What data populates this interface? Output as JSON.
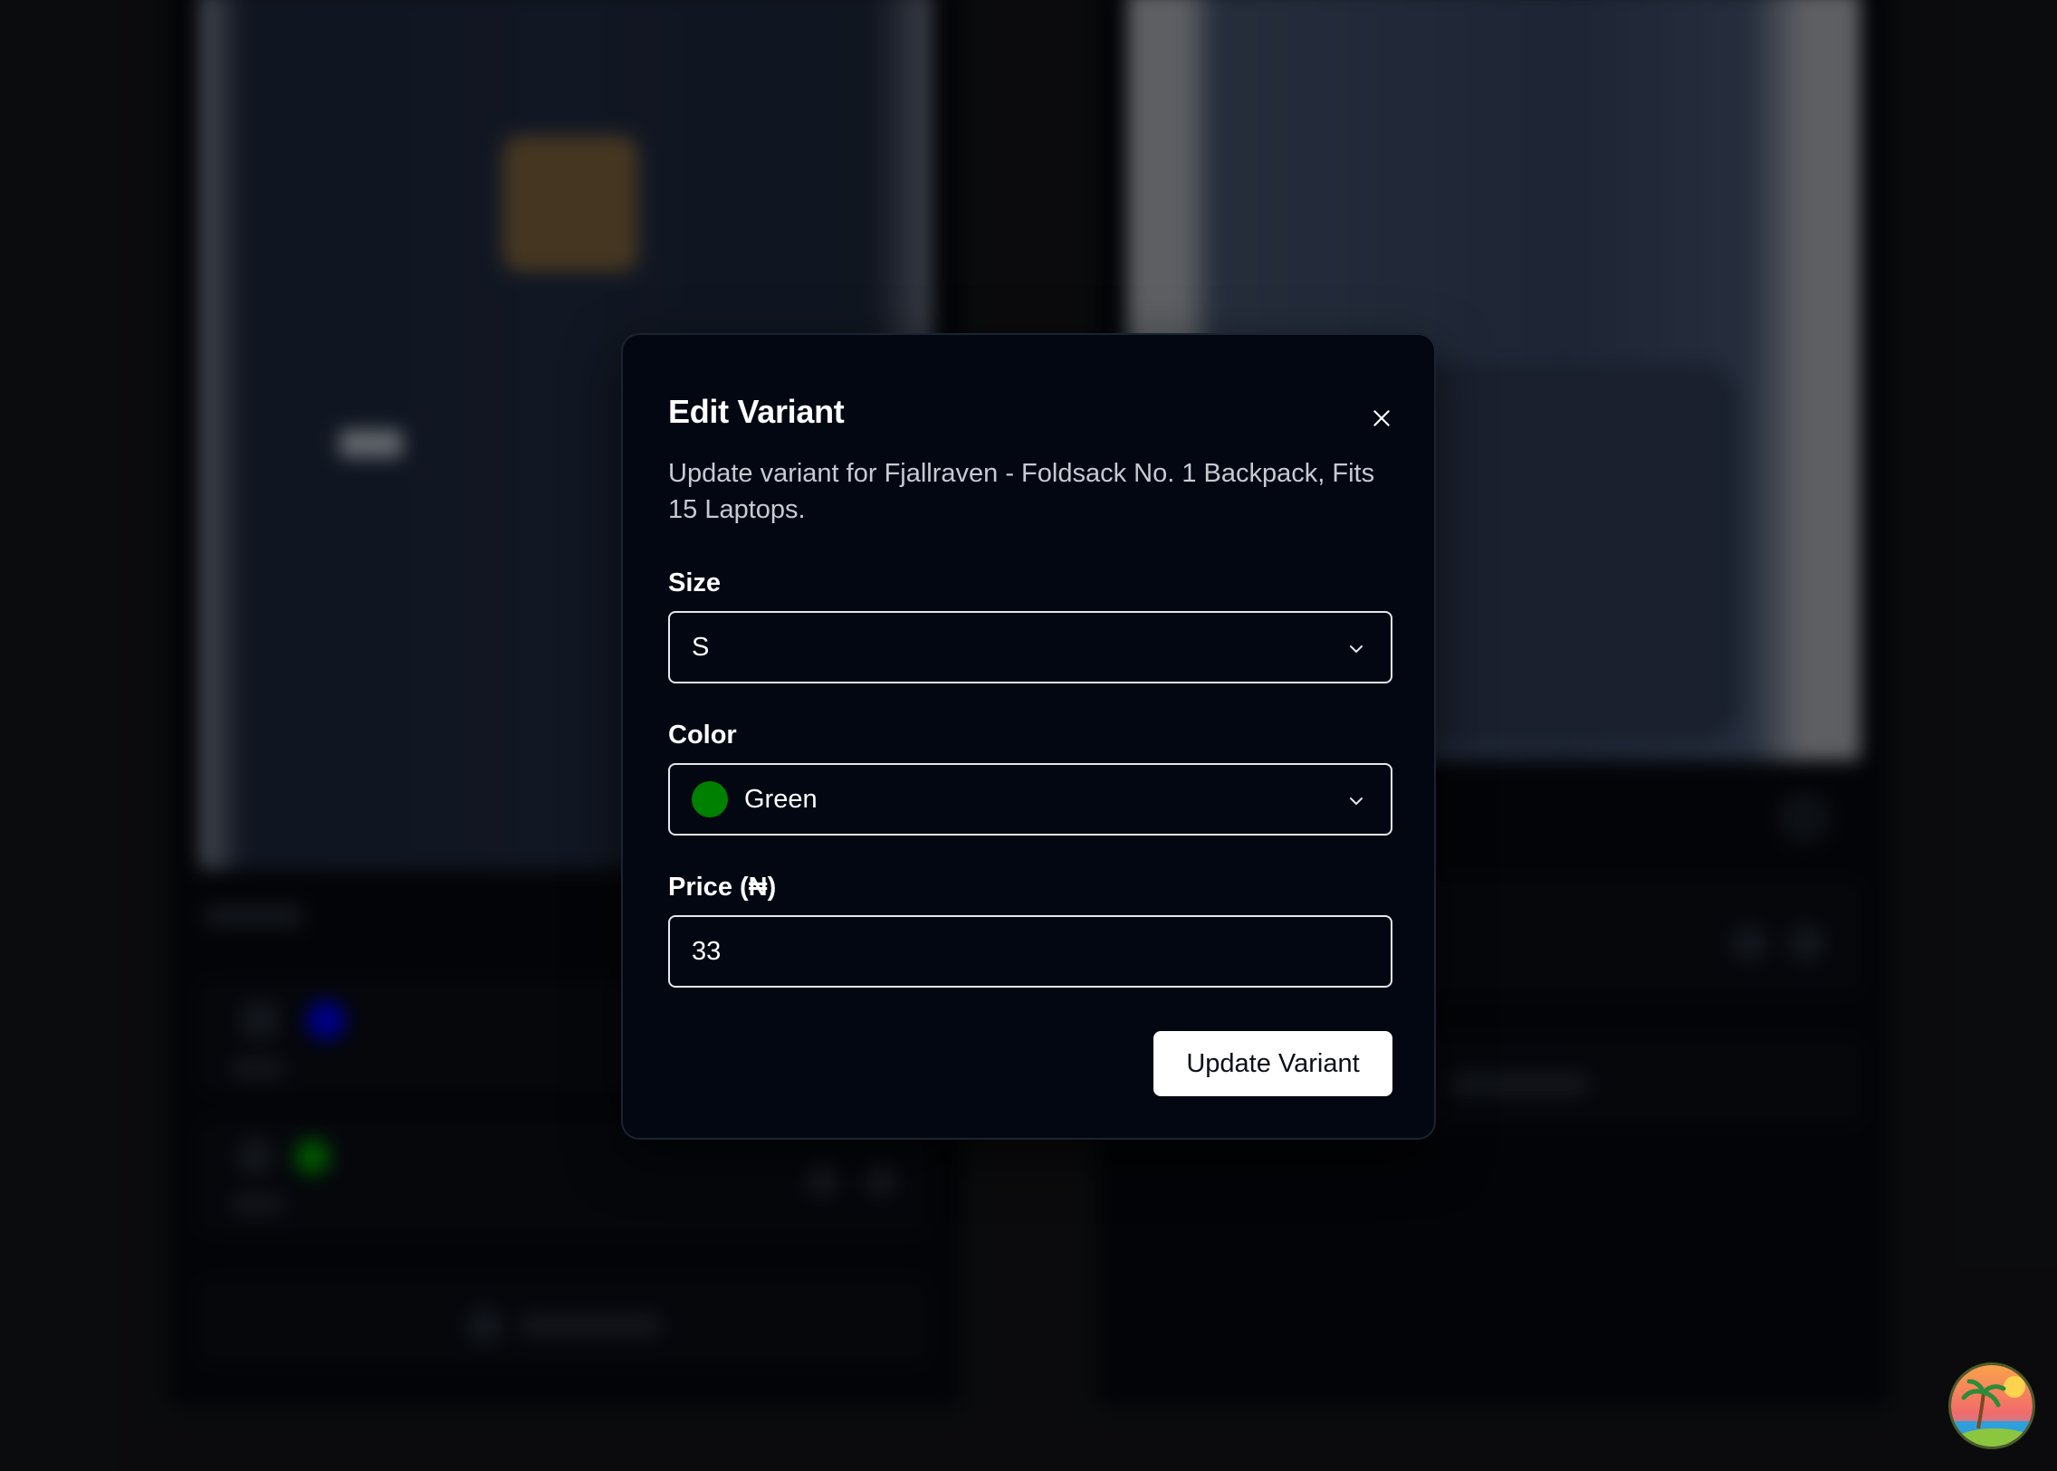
{
  "modal": {
    "title": "Edit Variant",
    "description": "Update variant for Fjallraven - Foldsack No. 1 Backpack, Fits 15 Laptops.",
    "size": {
      "label": "Size",
      "value": "S"
    },
    "color": {
      "label": "Color",
      "value": "Green",
      "swatch": "#008000"
    },
    "price": {
      "label": "Price (₦)",
      "value": "33"
    },
    "submit_label": "Update Variant",
    "close_icon": "close-icon"
  },
  "background": {
    "variant_swatches": [
      "#0000cc",
      "#008000"
    ]
  },
  "avatar": {
    "icon": "tropical-island-icon"
  }
}
